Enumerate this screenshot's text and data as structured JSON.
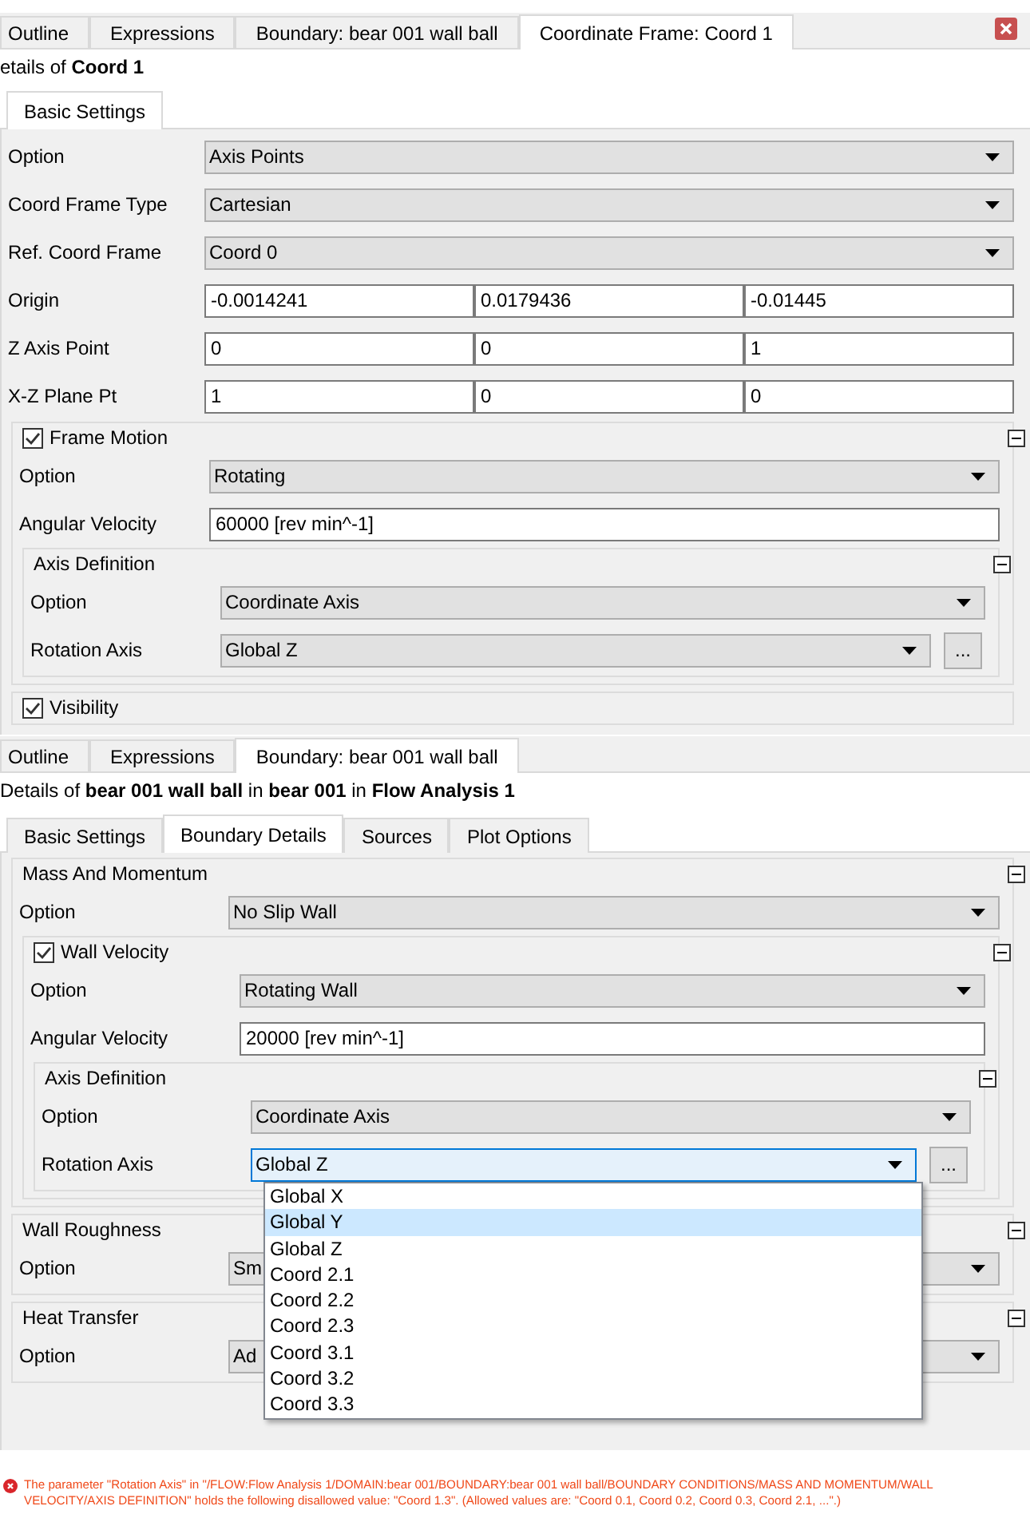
{
  "coord_panel": {
    "tabs": [
      {
        "label": "Outline",
        "selected": false
      },
      {
        "label": "Expressions",
        "selected": false
      },
      {
        "label": "Boundary: bear 001 wall ball",
        "selected": false
      },
      {
        "label": "Coordinate Frame: Coord 1",
        "selected": true
      }
    ],
    "details": "etails of **Coord 1**",
    "subtabs": [
      {
        "label": "Basic Settings",
        "selected": true
      }
    ],
    "fields": [
      {
        "label": "Option",
        "kind": "select",
        "value": "Axis Points"
      },
      {
        "label": "Coord Frame Type",
        "kind": "select",
        "value": "Cartesian"
      },
      {
        "label": "Ref. Coord Frame",
        "kind": "select",
        "value": "Coord 0"
      },
      {
        "label": "Origin",
        "kind": "triple",
        "values": [
          "-0.0014241",
          "0.0179436",
          "-0.01445"
        ]
      },
      {
        "label": "Z Axis Point",
        "kind": "triple",
        "values": [
          "0",
          "0",
          "1"
        ]
      },
      {
        "label": "X-Z Plane Pt",
        "kind": "triple",
        "values": [
          "1",
          "0",
          "0"
        ]
      }
    ],
    "groups": [
      {
        "title": "Frame Motion",
        "checked": true,
        "expanded": true,
        "fields": [
          {
            "label": "Option",
            "kind": "select",
            "value": "Rotating"
          },
          {
            "label": "Angular Velocity",
            "kind": "text",
            "value": "60000 [rev min^-1]"
          }
        ],
        "groups": [
          {
            "title": "Axis Definition",
            "expanded": true,
            "fields": [
              {
                "label": "Option",
                "kind": "select",
                "value": "Coordinate Axis"
              },
              {
                "label": "Rotation Axis",
                "kind": "select",
                "value": "Global Z",
                "button": "..."
              }
            ]
          }
        ]
      },
      {
        "title": "Visibility",
        "checked": true
      }
    ]
  },
  "boundary_panel": {
    "tabs": [
      {
        "label": "Outline",
        "selected": false
      },
      {
        "label": "Expressions",
        "selected": false
      },
      {
        "label": "Boundary: bear 001 wall ball",
        "selected": true
      }
    ],
    "details": "Details of **bear 001 wall ball** in **bear 001** in **Flow Analysis 1**",
    "subtabs": [
      {
        "label": "Basic Settings",
        "selected": false
      },
      {
        "label": "Boundary Details",
        "selected": true
      },
      {
        "label": "Sources",
        "selected": false
      },
      {
        "label": "Plot Options",
        "selected": false
      }
    ],
    "groups": [
      {
        "title": "Mass And Momentum",
        "expanded": true,
        "fields": [
          {
            "label": "Option",
            "kind": "select",
            "value": "No Slip Wall"
          }
        ],
        "groups": [
          {
            "title": "Wall Velocity",
            "checked": true,
            "expanded": true,
            "fields": [
              {
                "label": "Option",
                "kind": "select",
                "value": "Rotating Wall"
              },
              {
                "label": "Angular Velocity",
                "kind": "text",
                "value": "20000 [rev min^-1]"
              }
            ],
            "groups": [
              {
                "title": "Axis Definition",
                "expanded": true,
                "fields": [
                  {
                    "label": "Option",
                    "kind": "select",
                    "value": "Coordinate Axis"
                  },
                  {
                    "label": "Rotation Axis",
                    "kind": "select",
                    "value": "Global Z",
                    "button": "...",
                    "focused": true,
                    "options": [
                      {
                        "label": "Global X",
                        "highlighted": false
                      },
                      {
                        "label": "Global Y",
                        "highlighted": true
                      },
                      {
                        "label": "Global Z",
                        "highlighted": false
                      },
                      {
                        "label": "Coord 2.1",
                        "highlighted": false
                      },
                      {
                        "label": "Coord 2.2",
                        "highlighted": false
                      },
                      {
                        "label": "Coord 2.3",
                        "highlighted": false
                      },
                      {
                        "label": "Coord 3.1",
                        "highlighted": false
                      },
                      {
                        "label": "Coord 3.2",
                        "highlighted": false
                      },
                      {
                        "label": "Coord 3.3",
                        "highlighted": false
                      }
                    ]
                  }
                ]
              }
            ]
          }
        ]
      },
      {
        "title": "Wall Roughness",
        "expanded": true,
        "fields": [
          {
            "label": "Option",
            "kind": "select",
            "value": "Sm"
          }
        ]
      },
      {
        "title": "Heat Transfer",
        "expanded": true,
        "fields": [
          {
            "label": "Option",
            "kind": "select",
            "value": "Ad"
          }
        ]
      }
    ]
  },
  "error": {
    "message": "The parameter \"Rotation Axis\" in \"/FLOW:Flow Analysis 1/DOMAIN:bear 001/BOUNDARY:bear 001 wall ball/BOUNDARY CONDITIONS/MASS AND MOMENTUM/WALL VELOCITY/AXIS DEFINITION\" holds the following disallowed value: \"Coord 1.3\". (Allowed values are: \"Coord 0.1, Coord 0.2, Coord 0.3, Coord 2.1, ...\".)"
  }
}
